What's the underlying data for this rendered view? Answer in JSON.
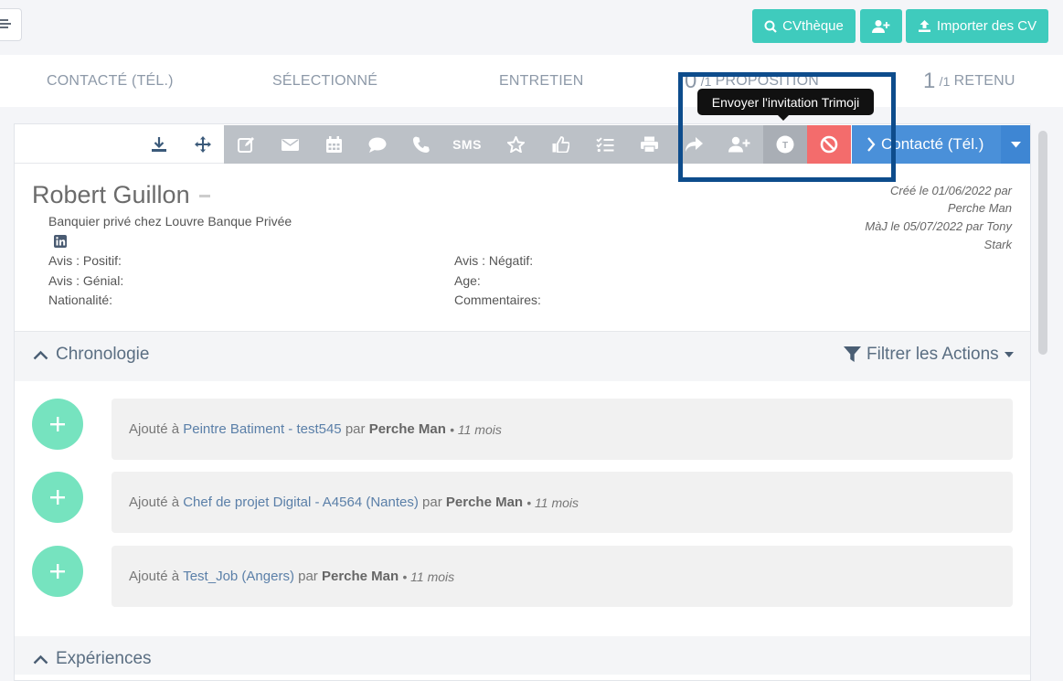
{
  "toolbar_top": {
    "cvtheque_label": "CVthèque",
    "import_label": "Importer des CV"
  },
  "pipeline": {
    "stages": [
      {
        "label": "CONTACTÉ (TÉL.)"
      },
      {
        "label": "SÉLECTIONNÉ"
      },
      {
        "label": "ENTRETIEN"
      },
      {
        "count": "0",
        "total": "/1",
        "label": "PROPOSITION"
      },
      {
        "count": "1",
        "total": "/1",
        "label": "RETENU"
      }
    ]
  },
  "actions": {
    "sms_label": "SMS",
    "tooltip": "Envoyer l'invitation Trimoji",
    "status_label": "Contacté (Tél.)"
  },
  "candidate": {
    "name": "Robert Guillon",
    "job": "Banquier privé chez Louvre Banque Privée",
    "fields": {
      "avis_positif": "Avis : Positif:",
      "avis_negatif": "Avis : Négatif:",
      "avis_genial": "Avis : Génial:",
      "age": "Age:",
      "nationalite": "Nationalité:",
      "commentaires": "Commentaires:"
    },
    "meta": {
      "created_1": "Créé le 01/06/2022 par",
      "created_2": "Perche Man",
      "updated_1": "MàJ le 05/07/2022 par Tony",
      "updated_2": "Stark"
    }
  },
  "chronologie": {
    "title": "Chronologie",
    "filter_label": "Filtrer les Actions",
    "items": [
      {
        "prefix": "Ajouté à",
        "job": "Peintre Batiment - test545",
        "par": "par",
        "user": "Perche Man",
        "time": "• 11 mois"
      },
      {
        "prefix": "Ajouté à",
        "job": "Chef de projet Digital - A4564 (Nantes)",
        "par": "par",
        "user": "Perche Man",
        "time": "• 11 mois"
      },
      {
        "prefix": "Ajouté à",
        "job": "Test_Job (Angers)",
        "par": "par",
        "user": "Perche Man",
        "time": "• 11 mois"
      }
    ]
  },
  "experiences": {
    "title": "Expériences"
  },
  "colors": {
    "teal": "#3fcbbd",
    "blue": "#4a90d9",
    "red": "#f36c6c",
    "green": "#76e3bf",
    "highlight": "#0d4c8c"
  }
}
